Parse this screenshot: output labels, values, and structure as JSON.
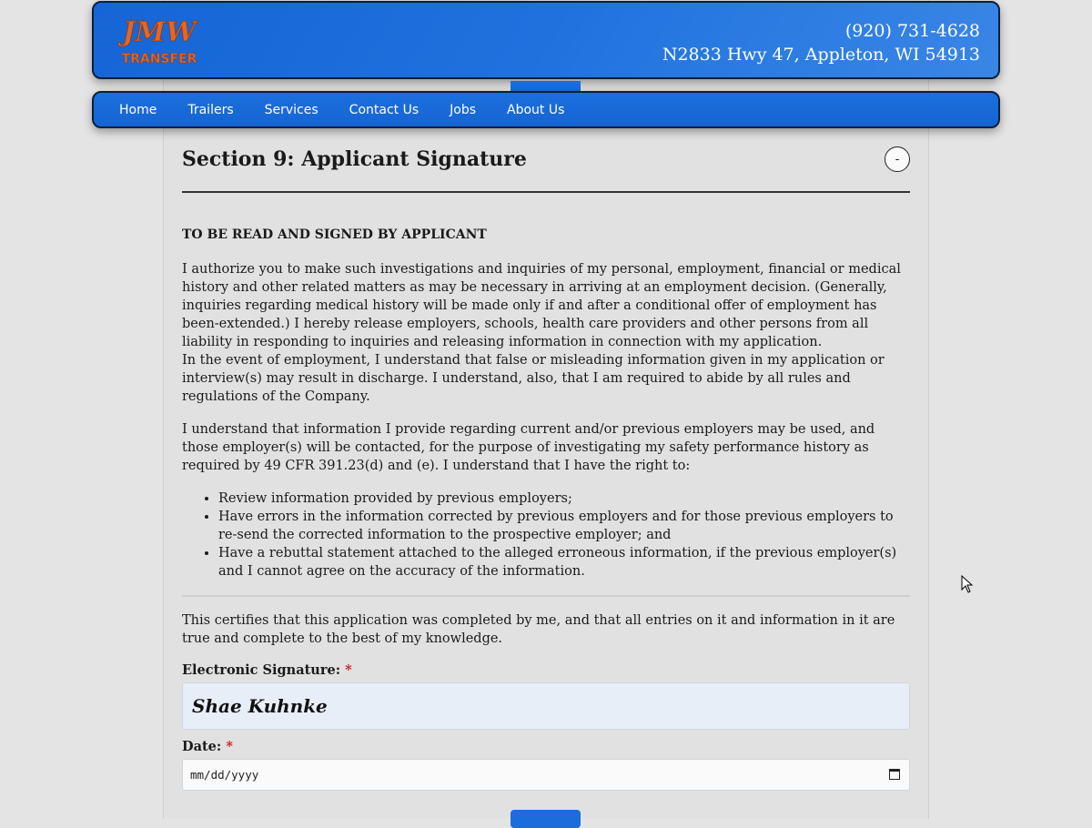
{
  "header": {
    "logo_text_top": "JMW",
    "logo_text_bottom": "TRANSFER",
    "phone": "(920) 731-4628",
    "address": "N2833 Hwy 47, Appleton, WI 54913"
  },
  "nav": {
    "items": [
      {
        "label": "Home"
      },
      {
        "label": "Trailers"
      },
      {
        "label": "Services"
      },
      {
        "label": "Contact Us"
      },
      {
        "label": "Jobs"
      },
      {
        "label": "About Us"
      }
    ]
  },
  "section": {
    "title": "Section 9: Applicant Signature",
    "collapse_label": "-",
    "heading": "TO BE READ AND SIGNED BY APPLICANT",
    "para1_a": "I authorize you to make such investigations and inquiries of my personal, employment, financial or medical history and other related matters as may be necessary in arriving at an employment decision. (Generally, inquiries regarding medical history will be made only if and after a conditional offer of employment has been-extended.) I hereby release employers, schools, health care providers and other persons from all liability in responding to inquiries and releasing information in connection with my application.",
    "para1_b": "In the event of employment, I understand that false or misleading information given in my application or interview(s) may result in discharge. I understand, also, that I am required to abide by all rules and regulations of the Company.",
    "para2": "I understand that information I provide regarding current and/or previous employers may be used, and those employer(s) will be contacted, for the purpose of investigating my safety performance history as required by 49 CFR 391.23(d) and (e). I understand that I have the right to:",
    "rights": [
      "Review information provided by previous employers;",
      "Have errors in the information corrected by previous employers and for those previous employers to re-send the corrected information to the prospective employer; and",
      "Have a rebuttal statement attached to the alleged erroneous information, if the previous employer(s) and I cannot agree on the accuracy of the information."
    ],
    "certify": "This certifies that this application was completed by me, and that all entries on it and information in it are true and complete to the best of my knowledge."
  },
  "form": {
    "signature_label": "Electronic Signature:",
    "signature_value": "Shae Kuhnke",
    "date_label": "Date:",
    "date_placeholder": "mm/dd/yyyy",
    "required_mark": "*"
  },
  "colors": {
    "header_blue": "#1565d6",
    "required_red": "#c41f1f",
    "logo_orange": "#e2662a"
  }
}
